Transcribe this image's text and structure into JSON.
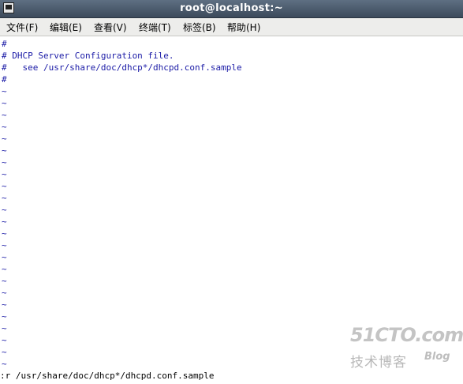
{
  "window": {
    "title": "root@localhost:~"
  },
  "menu": {
    "items": [
      {
        "label": "文件(F)"
      },
      {
        "label": "编辑(E)"
      },
      {
        "label": "查看(V)"
      },
      {
        "label": "终端(T)"
      },
      {
        "label": "标签(B)"
      },
      {
        "label": "帮助(H)"
      }
    ]
  },
  "editor": {
    "lines": [
      "#",
      "# DHCP Server Configuration file.",
      "#   see /usr/share/doc/dhcp*/dhcpd.conf.sample",
      "#"
    ],
    "tilde": "~",
    "command_line": ":r /usr/share/doc/dhcp*/dhcpd.conf.sample"
  },
  "watermark": {
    "main": "51CTO.com",
    "sub": "技术博客",
    "blog": "Blog"
  },
  "colors": {
    "titlebar": "#3c4a5b",
    "text_blue": "#1a1aa6",
    "menubar": "#ededeb"
  }
}
